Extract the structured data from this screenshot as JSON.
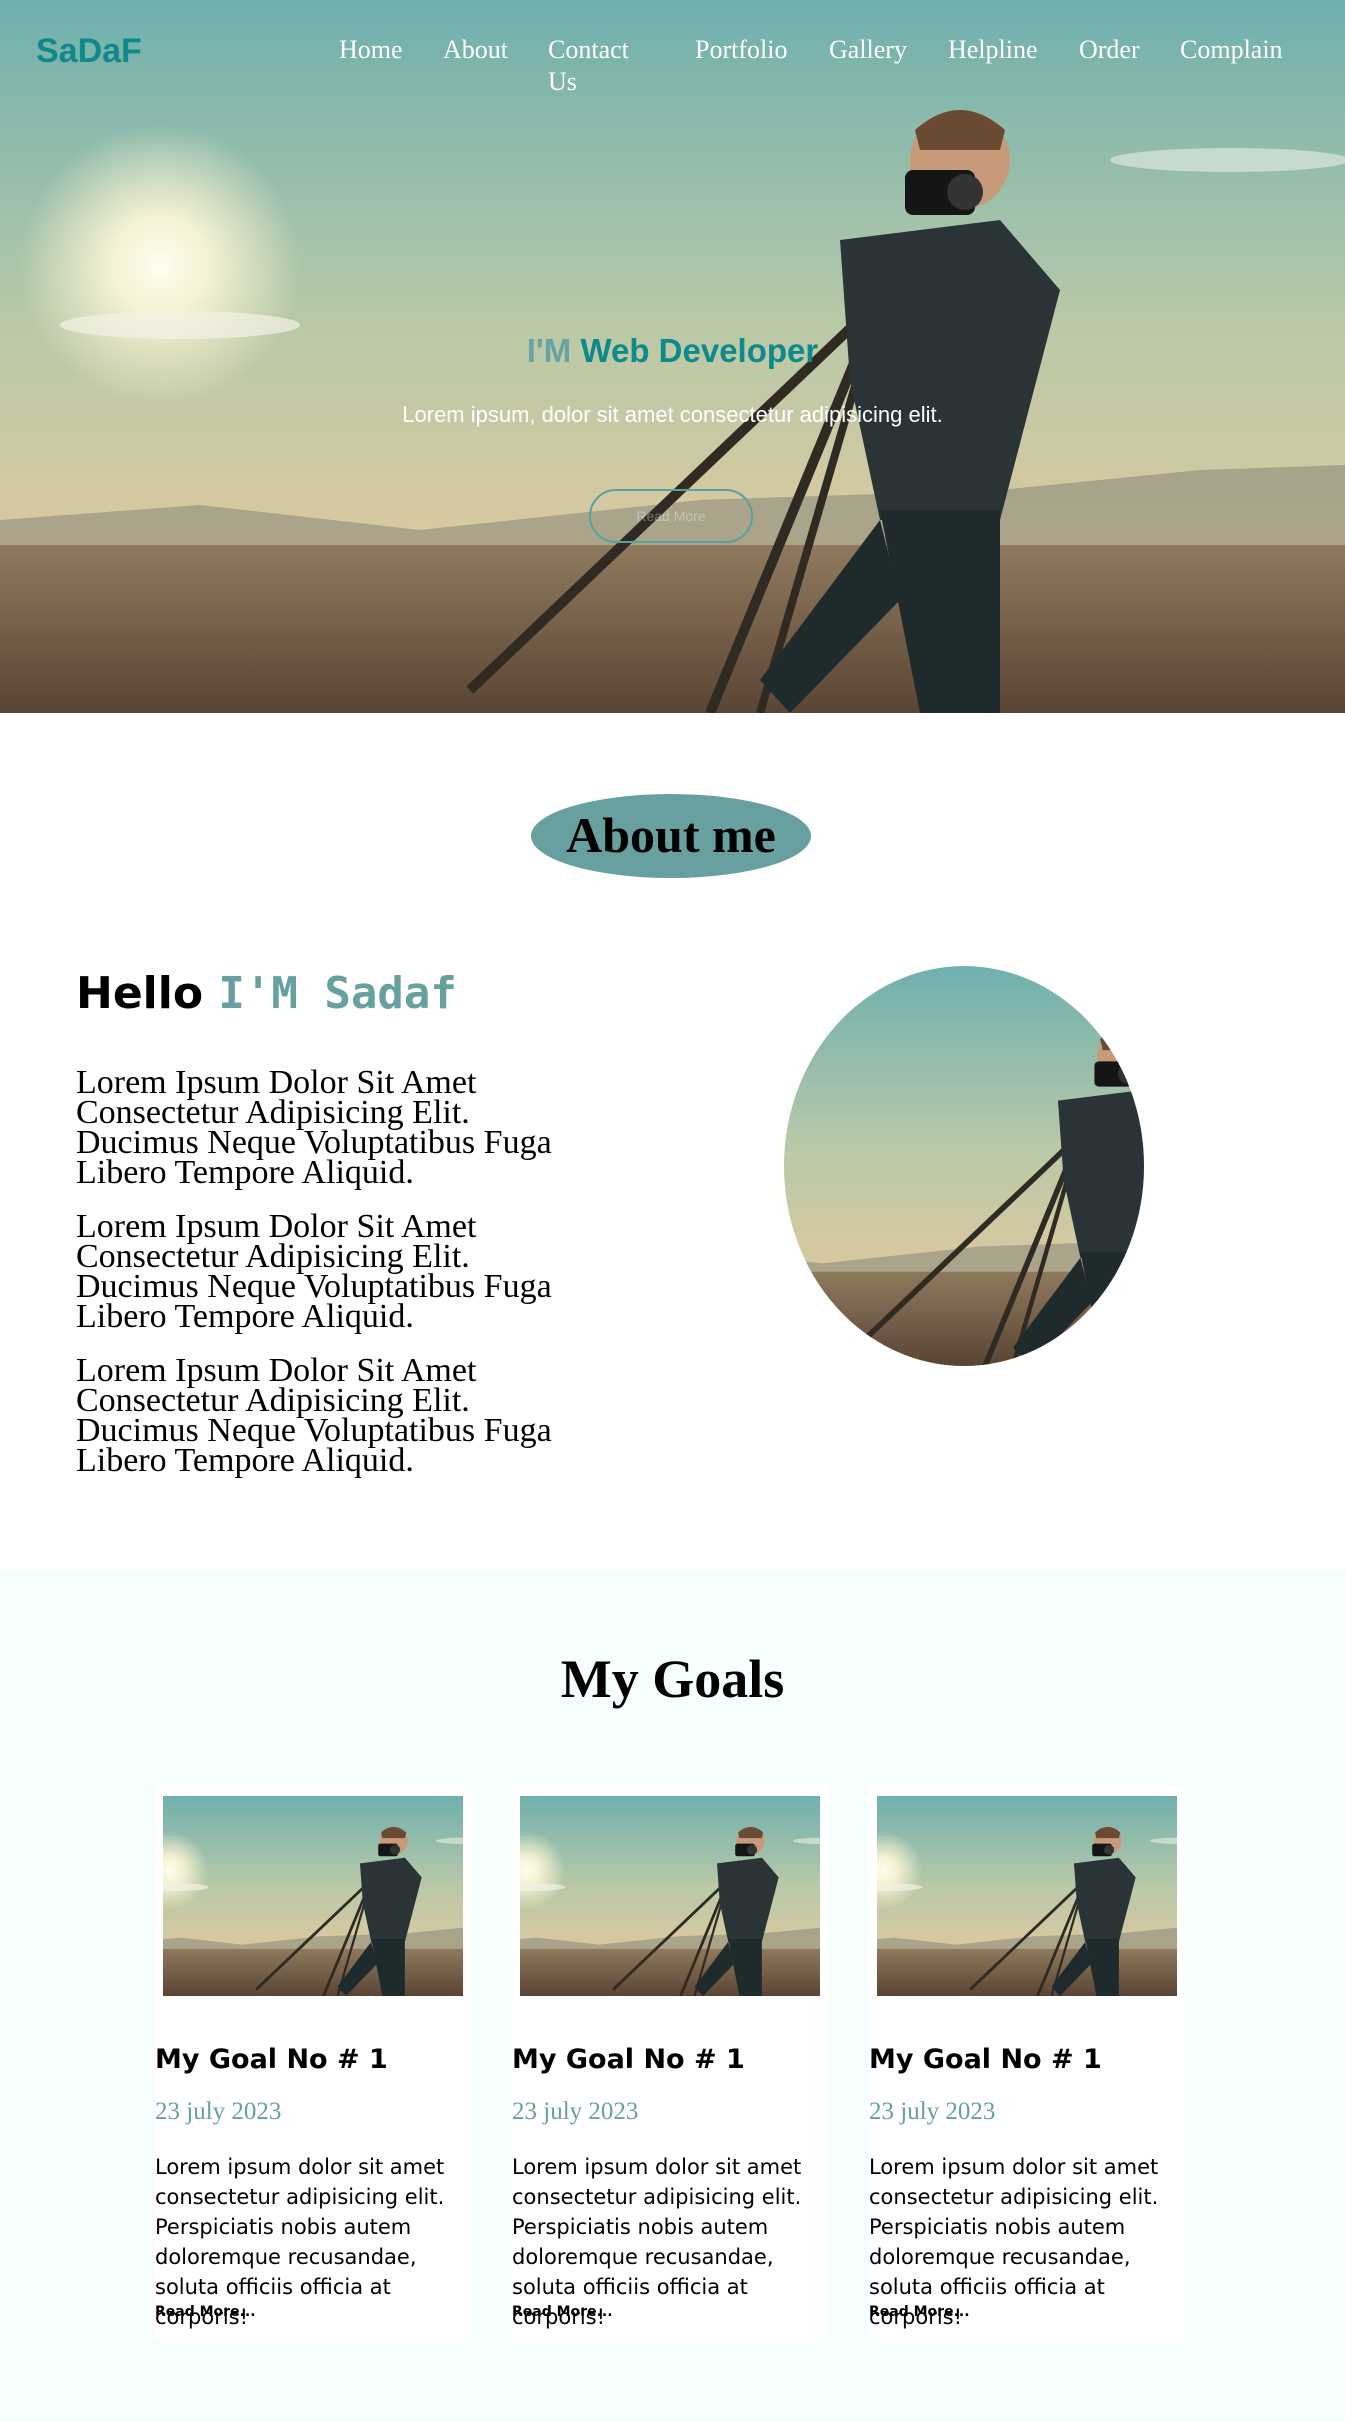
{
  "site": {
    "logo": "SaDaF"
  },
  "nav": {
    "items": [
      {
        "label": "Home"
      },
      {
        "label": "About"
      },
      {
        "label": "Contact Us"
      },
      {
        "label": "Portfolio"
      },
      {
        "label": "Gallery"
      },
      {
        "label": "Helpline"
      },
      {
        "label": "Order"
      },
      {
        "label": "Complain"
      }
    ]
  },
  "hero": {
    "title_prefix": "I'M",
    "title_highlight": "Web Developer",
    "subtitle": "Lorem ipsum, dolor sit amet consectetur adipisicing elit.",
    "button_label": "Read More",
    "image_icon": "photographer-with-tripod-image"
  },
  "about": {
    "heading": "About me",
    "hello": "Hello",
    "name": "I'M Sadaf",
    "paragraphs": [
      "Lorem Ipsum Dolor Sit Amet Consectetur Adipisicing Elit. Ducimus Neque Voluptatibus Fuga Libero Tempore Aliquid.",
      "Lorem Ipsum Dolor Sit Amet Consectetur Adipisicing Elit. Ducimus Neque Voluptatibus Fuga Libero Tempore Aliquid.",
      "Lorem Ipsum Dolor Sit Amet Consectetur Adipisicing Elit. Ducimus Neque Voluptatibus Fuga Libero Tempore Aliquid."
    ]
  },
  "goals": {
    "heading": "My Goals",
    "cards": [
      {
        "title": "My Goal No # 1",
        "date": "23 july 2023",
        "text": "Lorem ipsum dolor sit amet consectetur adipisicing elit. Perspiciatis nobis autem doloremque recusandae, soluta officiis officia at corporis!",
        "link": "Read More..."
      },
      {
        "title": "My Goal No # 1",
        "date": "23 july 2023",
        "text": "Lorem ipsum dolor sit amet consectetur adipisicing elit. Perspiciatis nobis autem doloremque recusandae, soluta officiis officia at corporis!",
        "link": "Read More..."
      },
      {
        "title": "My Goal No # 1",
        "date": "23 july 2023",
        "text": "Lorem ipsum dolor sit amet consectetur adipisicing elit. Perspiciatis nobis autem doloremque recusandae, soluta officiis officia at corporis!",
        "link": "Read More..."
      }
    ]
  },
  "colors": {
    "accent": "#0e8a8a",
    "muted_teal": "#67a09e",
    "goals_bg": "#f6fffd"
  }
}
